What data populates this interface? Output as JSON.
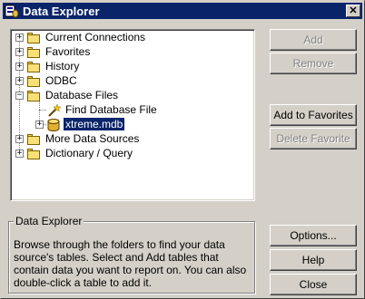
{
  "window": {
    "title": "Data Explorer",
    "close_glyph": "✕"
  },
  "tree": {
    "items": [
      {
        "label": "Current Connections",
        "expander": "+"
      },
      {
        "label": "Favorites",
        "expander": "+"
      },
      {
        "label": "History",
        "expander": "+"
      },
      {
        "label": "ODBC",
        "expander": "+"
      },
      {
        "label": "Database Files",
        "expander": "−"
      },
      {
        "label": "Find Database File",
        "expander": ""
      },
      {
        "label": "xtreme.mdb",
        "expander": "+"
      },
      {
        "label": "More Data Sources",
        "expander": "+"
      },
      {
        "label": "Dictionary / Query",
        "expander": "+"
      }
    ]
  },
  "buttons": {
    "add": "Add",
    "remove": "Remove",
    "add_to_favorites": "Add to Favorites",
    "delete_favorite": "Delete Favorite",
    "options": "Options...",
    "help": "Help",
    "close": "Close"
  },
  "description": {
    "title": "Data Explorer",
    "text": "Browse through the folders to find your data source's tables.  Select and Add tables that contain data you want to report on.  You can also double-click a table to add it."
  },
  "colors": {
    "titlebar": "#0a246a",
    "selection": "#0a246a",
    "face": "#d4d0c8"
  }
}
